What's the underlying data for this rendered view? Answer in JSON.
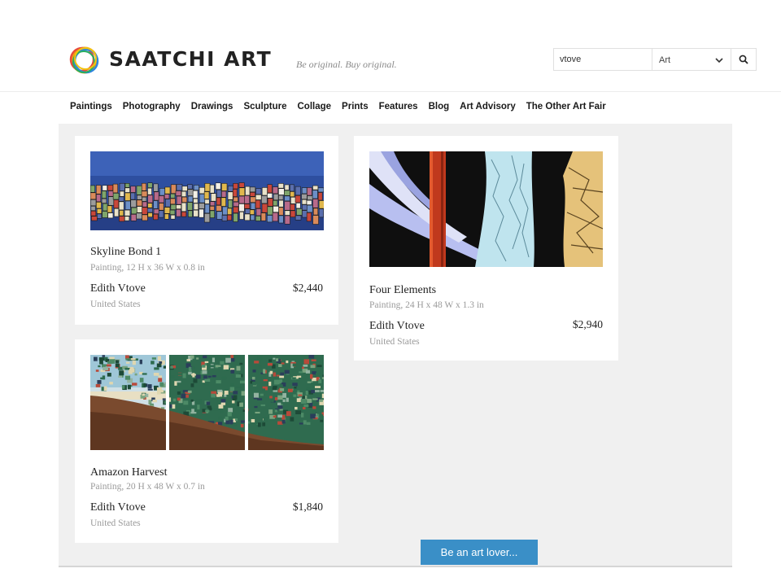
{
  "header": {
    "brand": "SAATCHI ART",
    "tagline": "Be original. Buy original.",
    "logo_icon": "rainbow-ring-logo"
  },
  "search": {
    "value": "vtove",
    "category": "Art",
    "button_icon": "search-icon"
  },
  "nav": {
    "items": [
      "Paintings",
      "Photography",
      "Drawings",
      "Sculpture",
      "Collage",
      "Prints",
      "Features",
      "Blog",
      "Art Advisory",
      "The Other Art Fair"
    ]
  },
  "artworks": [
    {
      "title": "Skyline Bond 1",
      "details": "Painting, 12 H x 36 W x 0.8 in",
      "artist": "Edith Vtove",
      "price": "$2,440",
      "country": "United States"
    },
    {
      "title": "Four Elements",
      "details": "Painting, 24 H x 48 W x 1.3 in",
      "artist": "Edith Vtove",
      "price": "$2,940",
      "country": "United States"
    },
    {
      "title": "Amazon Harvest",
      "details": "Painting, 20 H x 48 W x 0.7 in",
      "artist": "Edith Vtove",
      "price": "$1,840",
      "country": "United States"
    }
  ],
  "cta": {
    "label": "Be an art lover..."
  },
  "colors": {
    "accent": "#3a8fc7",
    "background": "#f0f0f0",
    "text": "#222222",
    "muted": "#9a9a9a"
  }
}
